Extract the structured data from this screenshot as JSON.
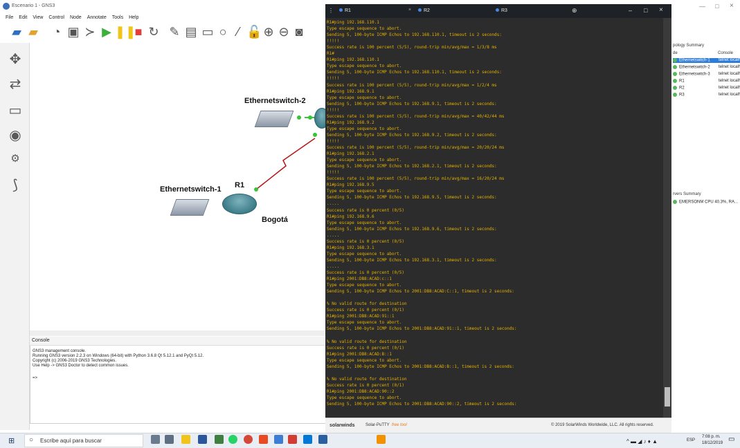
{
  "window": {
    "title": "Escenario 1 - GNS3",
    "min": "—",
    "max": "□",
    "close": "×"
  },
  "menu": [
    "File",
    "Edit",
    "View",
    "Control",
    "Node",
    "Annotate",
    "Tools",
    "Help"
  ],
  "topology": {
    "nodes": [
      {
        "label": "Ethernetswitch-2"
      },
      {
        "label": "Ethernetswitch-1"
      },
      {
        "label": "R1"
      },
      {
        "label": "Bogotá"
      }
    ]
  },
  "console": {
    "title": "Console",
    "lines": [
      "GNS3 management console.",
      "Running GNS3 version 2.2.3 on Windows (64-bit) with Python 3.6.8 Qt 5.12.1 and PyQt 5.12.",
      "Copyright (c) 2006-2019 GNS3 Technologies.",
      "Use Help -> GNS3 Doctor to detect common issues.",
      "",
      "=>"
    ]
  },
  "putty": {
    "tabs": [
      "R1",
      "R2",
      "R3"
    ],
    "new_tab": "⊕",
    "terminal_lines": [
      "R1#ping 192.168.110.1",
      "Type escape sequence to abort.",
      "Sending 5, 100-byte ICMP Echos to 192.168.110.1, timeout is 2 seconds:",
      "!!!!!",
      "Success rate is 100 percent (5/5), round-trip min/avg/max = 1/3/8 ms",
      "R1#",
      "R1#ping 192.168.110.1",
      "Type escape sequence to abort.",
      "Sending 5, 100-byte ICMP Echos to 192.168.110.1, timeout is 2 seconds:",
      "!!!!!",
      "Success rate is 100 percent (5/5), round-trip min/avg/max = 1/2/4 ms",
      "R1#ping 192.168.9.1",
      "Type escape sequence to abort.",
      "Sending 5, 100-byte ICMP Echos to 192.168.9.1, timeout is 2 seconds:",
      "!!!!!",
      "Success rate is 100 percent (5/5), round-trip min/avg/max = 40/42/44 ms",
      "R1#ping 192.168.9.2",
      "Type escape sequence to abort.",
      "Sending 5, 100-byte ICMP Echos to 192.168.9.2, timeout is 2 seconds:",
      "!!!!!",
      "Success rate is 100 percent (5/5), round-trip min/avg/max = 20/20/24 ms",
      "R1#ping 192.168.2.1",
      "Type escape sequence to abort.",
      "Sending 5, 100-byte ICMP Echos to 192.168.2.1, timeout is 2 seconds:",
      "!!!!!",
      "Success rate is 100 percent (5/5), round-trip min/avg/max = 16/20/24 ms",
      "R1#ping 192.168.9.5",
      "Type escape sequence to abort.",
      "Sending 5, 100-byte ICMP Echos to 192.168.9.5, timeout is 2 seconds:",
      ".....",
      "Success rate is 0 percent (0/5)",
      "R1#ping 192.168.9.6",
      "Type escape sequence to abort.",
      "Sending 5, 100-byte ICMP Echos to 192.168.9.6, timeout is 2 seconds:",
      ".....",
      "Success rate is 0 percent (0/5)",
      "R1#ping 192.168.3.1",
      "Type escape sequence to abort.",
      "Sending 5, 100-byte ICMP Echos to 192.168.3.1, timeout is 2 seconds:",
      ".....",
      "Success rate is 0 percent (0/5)",
      "R1#ping 2001:DB8:ACAD:c::1",
      "Type escape sequence to abort.",
      "Sending 5, 100-byte ICMP Echos to 2001:DB8:ACAD:C::1, timeout is 2 seconds:",
      "",
      "% No valid route for destination",
      "Success rate is 0 percent (0/1)",
      "R1#ping 2001:DB8:ACAD:91::1",
      "Type escape sequence to abort.",
      "Sending 5, 100-byte ICMP Echos to 2001:DB8:ACAD:91::1, timeout is 2 seconds:",
      "",
      "% No valid route for destination",
      "Success rate is 0 percent (0/1)",
      "R1#ping 2001:DB8:ACAD:B::1",
      "Type escape sequence to abort.",
      "Sending 5, 100-byte ICMP Echos to 2001:DB8:ACAD:B::1, timeout is 2 seconds:",
      "",
      "% No valid route for destination",
      "Success rate is 0 percent (0/1)",
      "R1#ping 2001:DB8:ACAD:90::2",
      "Type escape sequence to abort.",
      "Sending 5, 100-byte ICMP Echos to 2001:DB8:ACAD:90::2, timeout is 2 seconds:"
    ],
    "footer_brand": "solarwinds",
    "footer_product": "Solar-PuTTY",
    "footer_free": "free tool",
    "footer_copyright": "© 2019 SolarWinds Worldwide, LLC. All rights reserved."
  },
  "topology_summary": {
    "title": "pology Summary",
    "col_node": "de",
    "col_console": "Console",
    "rows": [
      {
        "name": "Ethernetswitch-1",
        "console": "telnet localh"
      },
      {
        "name": "Ethernetswitch-2",
        "console": "telnet localh"
      },
      {
        "name": "Ethernetswitch-3",
        "console": "telnet localh"
      },
      {
        "name": "R1",
        "console": "telnet localh"
      },
      {
        "name": "R2",
        "console": "telnet localh"
      },
      {
        "name": "R3",
        "console": "telnet localh"
      }
    ]
  },
  "servers_summary": {
    "title": "rvers Summary",
    "row": "EMERSONM CPU 40.3%, RA..."
  },
  "taskbar": {
    "search_placeholder": "Escribe aquí para buscar",
    "lang": "ESP",
    "time": "7:08 p. m.",
    "date": "18/12/2019"
  },
  "colors": {
    "terminal_text": "#e7b300",
    "link_green": "#35c535",
    "serial_red": "#b41616"
  }
}
